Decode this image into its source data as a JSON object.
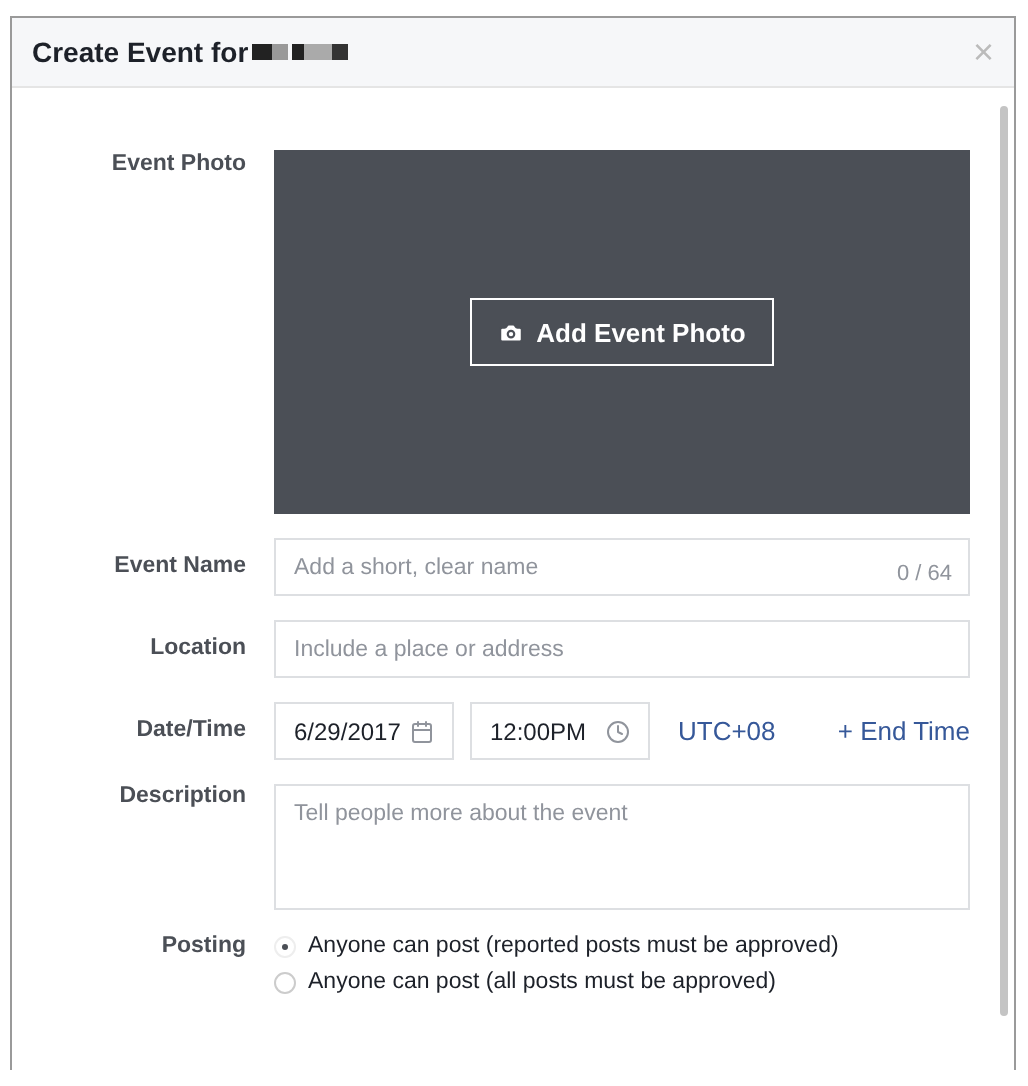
{
  "dialog": {
    "title": "Create Event for",
    "close": "×"
  },
  "photo": {
    "label": "Event Photo",
    "button": "Add Event Photo"
  },
  "event_name": {
    "label": "Event Name",
    "placeholder": "Add a short, clear name",
    "counter": "0 / 64"
  },
  "location": {
    "label": "Location",
    "placeholder": "Include a place or address"
  },
  "date_time": {
    "label": "Date/Time",
    "date": "6/29/2017",
    "time": "12:00PM",
    "timezone": "UTC+08",
    "end_time_link": "+ End Time"
  },
  "description": {
    "label": "Description",
    "placeholder": "Tell people more about the event"
  },
  "posting": {
    "label": "Posting",
    "options": [
      {
        "label": "Anyone can post (reported posts must be approved)",
        "selected": true
      },
      {
        "label": "Anyone can post (all posts must be approved)",
        "selected": false
      }
    ]
  }
}
